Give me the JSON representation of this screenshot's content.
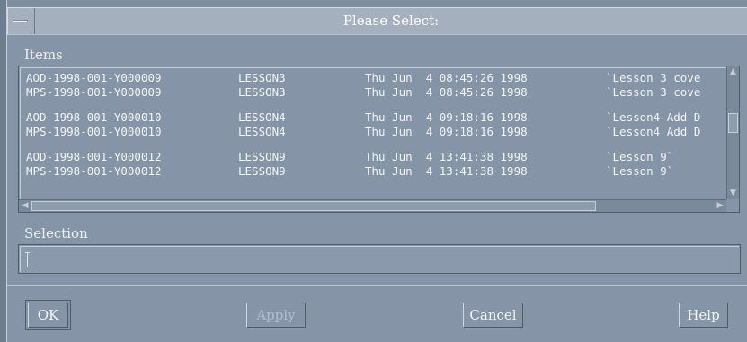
{
  "window": {
    "title": "Please Select:"
  },
  "items": {
    "label": "Items",
    "rows": [
      {
        "id": "AOD-1998-001-Y000009",
        "lesson": "LESSON3",
        "date": "Thu Jun  4 08:45:26 1998",
        "comment": "`Lesson 3 cove"
      },
      {
        "id": "MPS-1998-001-Y000009",
        "lesson": "LESSON3",
        "date": "Thu Jun  4 08:45:26 1998",
        "comment": "`Lesson 3 cove"
      },
      {
        "id": "AOD-1998-001-Y000010",
        "lesson": "LESSON4",
        "date": "Thu Jun  4 09:18:16 1998",
        "comment": "`Lesson4 Add D"
      },
      {
        "id": "MPS-1998-001-Y000010",
        "lesson": "LESSON4",
        "date": "Thu Jun  4 09:18:16 1998",
        "comment": "`Lesson4 Add D"
      },
      {
        "id": "AOD-1998-001-Y000012",
        "lesson": "LESSON9",
        "date": "Thu Jun  4 13:41:38 1998",
        "comment": "`Lesson 9`"
      },
      {
        "id": "MPS-1998-001-Y000012",
        "lesson": "LESSON9",
        "date": "Thu Jun  4 13:41:38 1998",
        "comment": "`Lesson 9`"
      }
    ]
  },
  "selection": {
    "label": "Selection",
    "value": ""
  },
  "buttons": {
    "ok": "OK",
    "apply": "Apply",
    "cancel": "Cancel",
    "help": "Help"
  }
}
